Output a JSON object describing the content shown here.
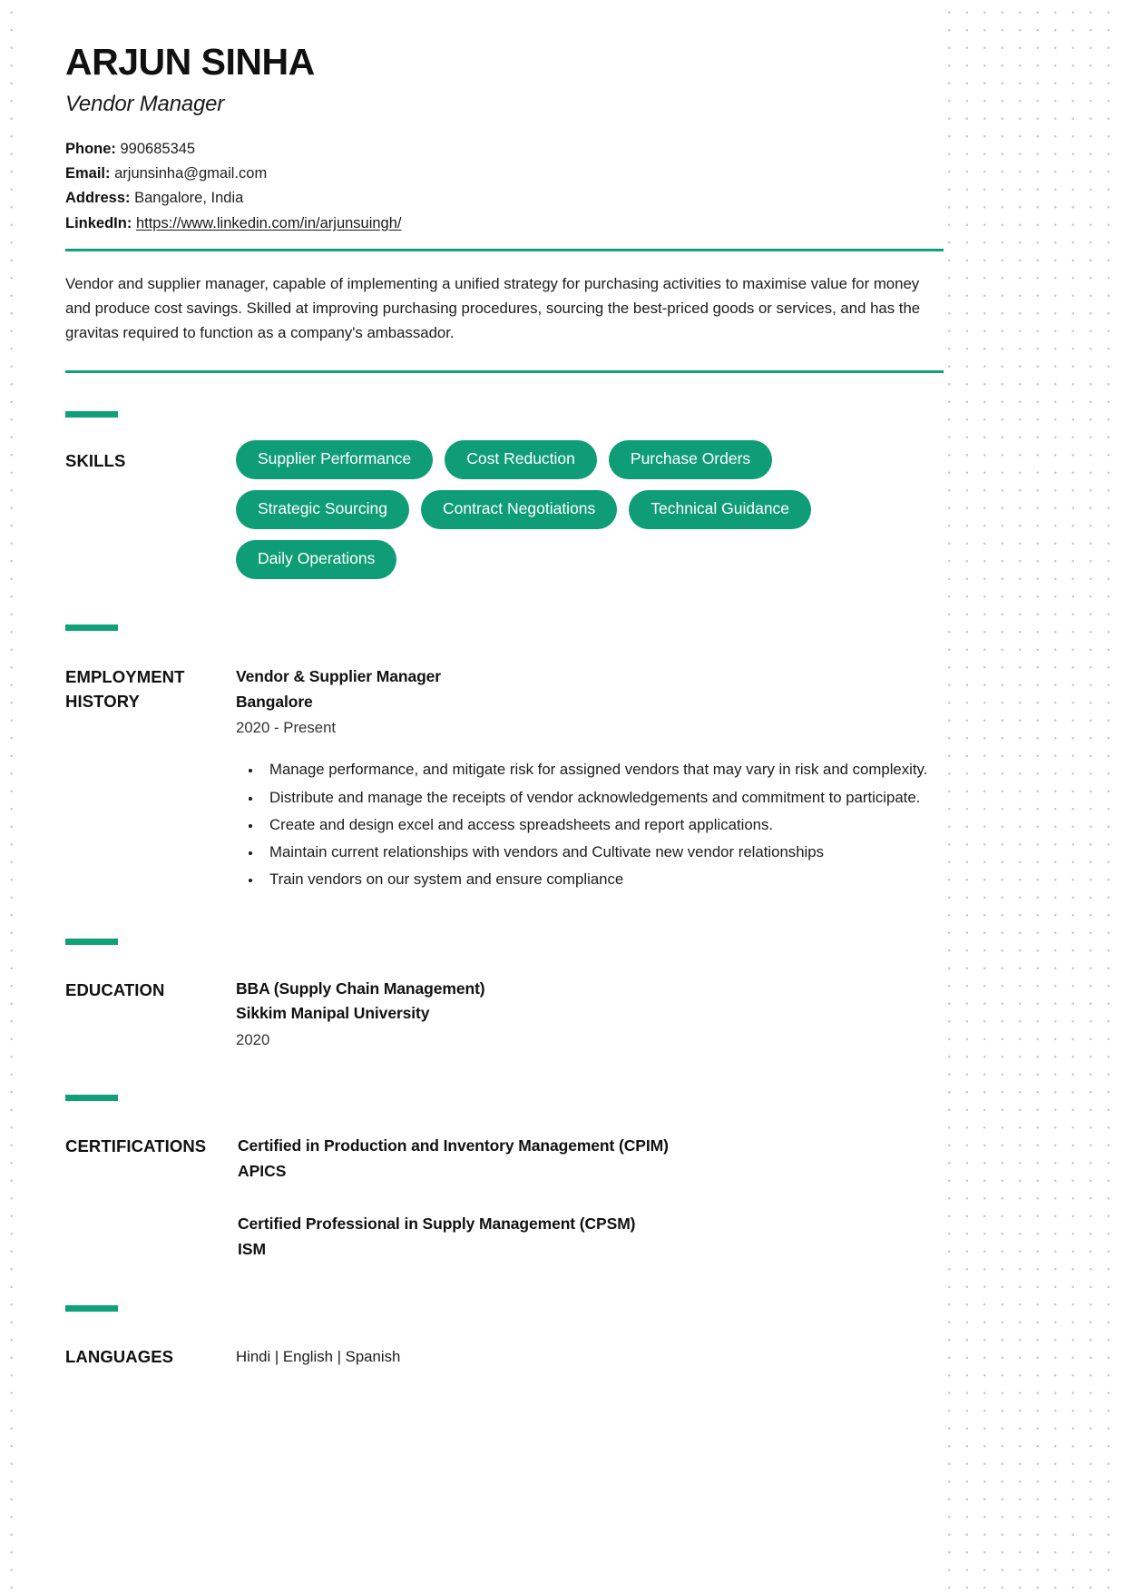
{
  "theme": {
    "accent": "#10a07a",
    "pill": "#0f9d77",
    "text": "#1c1c1c"
  },
  "header": {
    "name": "ARJUN SINHA",
    "job_title": "Vendor Manager",
    "contacts": [
      {
        "key": "Phone:",
        "value": " 990685345",
        "is_link": false
      },
      {
        "key": "Email:",
        "value": " arjunsinha@gmail.com",
        "is_link": false
      },
      {
        "key": "Address:",
        "value": " Bangalore, India",
        "is_link": false
      },
      {
        "key": "LinkedIn:",
        "value": "https://www.linkedin.com/in/arjunsuingh/",
        "is_link": true
      }
    ],
    "contact_phone_key": "Phone:",
    "contact_phone_value": " 990685345",
    "contact_email_key": "Email:",
    "contact_email_value": " arjunsinha@gmail.com",
    "contact_address_key": "Address:",
    "contact_address_value": " Bangalore, India",
    "contact_linkedin_key": "LinkedIn:",
    "contact_linkedin_value": "https://www.linkedin.com/in/arjunsuingh/"
  },
  "summary": {
    "text": "Vendor and supplier manager, capable of implementing a unified strategy for purchasing activities to maximise value for money and produce cost savings. Skilled at improving purchasing procedures, sourcing the best-priced goods or services, and has the gravitas required to function as a company's ambassador."
  },
  "skills": {
    "label": "SKILLS",
    "items": [
      "Supplier Performance",
      "Cost Reduction",
      "Purchase Orders",
      "Strategic Sourcing",
      "Contract Negotiations",
      "Technical Guidance",
      "Daily Operations"
    ]
  },
  "employment": {
    "label_line1": "EMPLOYMENT",
    "label_line2": "HISTORY",
    "entries": [
      {
        "title": "Vendor & Supplier Manager",
        "location": "Bangalore",
        "dates": "2020 - Present",
        "bullets": [
          "Manage performance, and mitigate risk for assigned vendors that may vary in risk and complexity.",
          "Distribute and manage the receipts of vendor acknowledgements and commitment to participate.",
          "Create and design excel and access spreadsheets and report applications.",
          "Maintain current relationships with vendors and   Cultivate new vendor relationships",
          "Train vendors on our system and ensure compliance"
        ]
      }
    ],
    "entry_title": "Vendor & Supplier Manager",
    "entry_location": "Bangalore",
    "entry_dates": "2020 - Present",
    "bullet_1": "Manage performance, and mitigate risk for assigned vendors that may vary in risk and complexity.",
    "bullet_2": "Distribute and manage the receipts of vendor acknowledgements and commitment to participate.",
    "bullet_3": "Create and design excel and access spreadsheets and report applications.",
    "bullet_4": "Maintain current relationships with vendors and   Cultivate new vendor relationships",
    "bullet_5": "Train vendors on our system and ensure compliance"
  },
  "education": {
    "label": "EDUCATION",
    "degree": "BBA (Supply Chain Management)",
    "institution": "Sikkim Manipal University",
    "year": "2020"
  },
  "certifications": {
    "label": "CERTIFICATIONS",
    "entries": [
      {
        "name": "Certified in Production and Inventory Management (CPIM)",
        "org": "APICS"
      },
      {
        "name": "Certified Professional in Supply Management (CPSM)",
        "org": "ISM"
      }
    ],
    "cert1_name": "Certified in Production and Inventory Management (CPIM)",
    "cert1_org": "APICS",
    "cert2_name": "Certified Professional in Supply Management (CPSM)",
    "cert2_org": "ISM"
  },
  "languages": {
    "label": "LANGUAGES",
    "text": "Hindi | English | Spanish"
  }
}
